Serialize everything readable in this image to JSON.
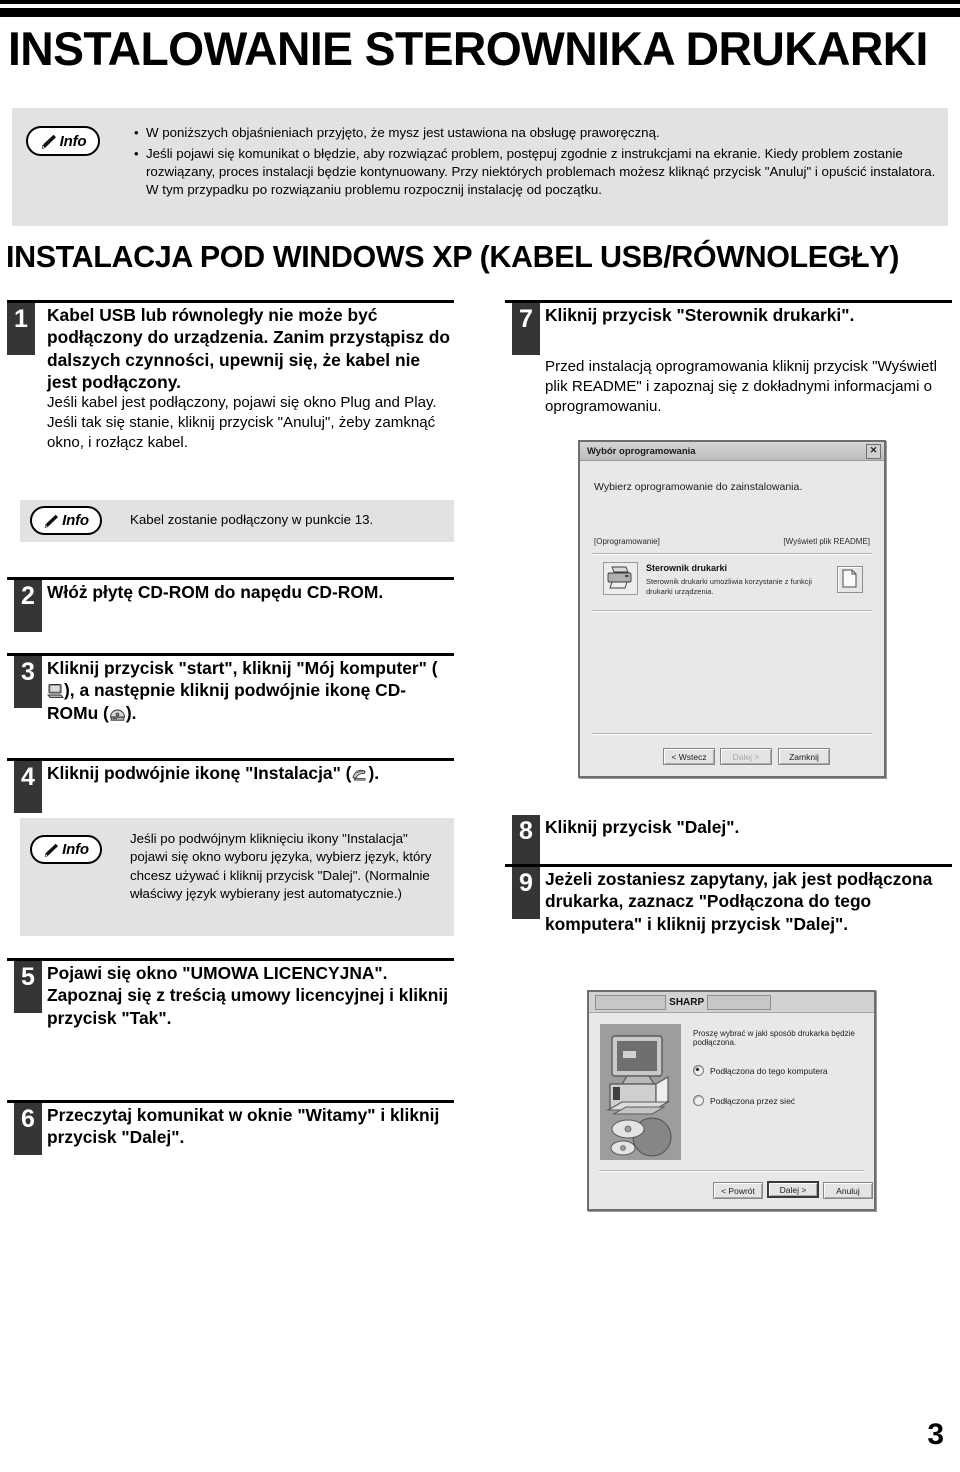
{
  "page_title": "INSTALOWANIE STEROWNIKA DRUKARKI",
  "section_heading": "INSTALACJA POD WINDOWS XP (KABEL USB/RÓWNOLEGŁY)",
  "page_number": "3",
  "info_label": "Info",
  "top_info": {
    "bullets": [
      "W poniższych objaśnieniach przyjęto, że mysz jest ustawiona na obsługę praworęczną.",
      "Jeśli pojawi się komunikat o błędzie, aby rozwiązać problem, postępuj zgodnie z instrukcjami na ekranie. Kiedy problem zostanie rozwiązany, proces instalacji będzie kontynuowany. Przy niektórych problemach możesz kliknąć przycisk \"Anuluj\" i opuścić instalatora. W tym przypadku po rozwiązaniu problemu rozpocznij instalację od początku."
    ]
  },
  "steps": [
    {
      "num": "1",
      "head": "Kabel USB lub równoległy nie może być podłączony do urządzenia. Zanim przystąpisz do dalszych czynności, upewnij się, że kabel nie jest podłączony.",
      "sub": "Jeśli kabel jest podłączony, pojawi się okno Plug and Play. Jeśli tak się stanie, kliknij przycisk \"Anuluj\", żeby zamknąć okno, i rozłącz kabel."
    },
    {
      "num": "2",
      "head": "Włóż płytę CD-ROM do napędu CD-ROM."
    },
    {
      "num": "3",
      "head_a": "Kliknij przycisk \"start\", kliknij \"Mój komputer\" (",
      "head_b": "), a następnie kliknij podwójnie ikonę CD-ROMu (",
      "head_c": ")."
    },
    {
      "num": "4",
      "head_a": "Kliknij podwójnie ikonę  \"Instalacja\" (",
      "head_c": ")."
    },
    {
      "num": "5",
      "head": "Pojawi się okno \"UMOWA LICENCYJNA\". Zapoznaj się z treścią umowy licencyjnej i kliknij przycisk \"Tak\"."
    },
    {
      "num": "6",
      "head": "Przeczytaj komunikat w oknie \"Witamy\" i kliknij przycisk \"Dalej\"."
    },
    {
      "num": "7",
      "head": "Kliknij przycisk \"Sterownik drukarki\".",
      "sub": "Przed instalacją oprogramowania kliknij przycisk \"Wyświetl plik README\" i zapoznaj się z dokładnymi informacjami o oprogramowaniu."
    },
    {
      "num": "8",
      "head": "Kliknij przycisk \"Dalej\"."
    },
    {
      "num": "9",
      "head": "Jeżeli zostaniesz zapytany, jak jest podłączona drukarka, zaznacz \"Podłączona do tego komputera\" i kliknij przycisk \"Dalej\"."
    }
  ],
  "info_step1": "Kabel zostanie podłączony w punkcie 13.",
  "info_step4": "Jeśli po podwójnym kliknięciu ikony \"Instalacja\" pojawi się okno wyboru języka, wybierz język, który chcesz używać i kliknij przycisk \"Dalej\". (Normalnie właściwy język wybierany jest automatycznie.)",
  "dialog_software": {
    "title": "Wybór oprogramowania",
    "close_label": "✕",
    "prompt": "Wybierz oprogramowanie do zainstalowania.",
    "col_left": "[Oprogramowanie]",
    "col_right": "[Wyświetl plik README]",
    "item_title": "Sterownik drukarki",
    "item_desc": "Sterownik drukarki umożliwia korzystanie z funkcji drukarki urządzenia.",
    "buttons": [
      {
        "label": "< Wstecz",
        "state": "normal"
      },
      {
        "label": "Dalej >",
        "state": "disabled"
      },
      {
        "label": "Zamknij",
        "state": "normal"
      }
    ]
  },
  "dialog_connection": {
    "brand": "SHARP",
    "prompt": "Proszę wybrać w jaki sposób drukarka będzie podłączona.",
    "options": [
      {
        "label": "Podłączona do tego komputera",
        "selected": true
      },
      {
        "label": "Podłączona przez sieć",
        "selected": false
      }
    ],
    "buttons": [
      {
        "label": "< Powrót",
        "state": "normal"
      },
      {
        "label": "Dalej >",
        "state": "default"
      },
      {
        "label": "Anuluj",
        "state": "normal"
      }
    ]
  },
  "colors": {
    "info_bg": "#e2e2e2",
    "step_num_bg": "#353535",
    "rule": "#000000"
  }
}
